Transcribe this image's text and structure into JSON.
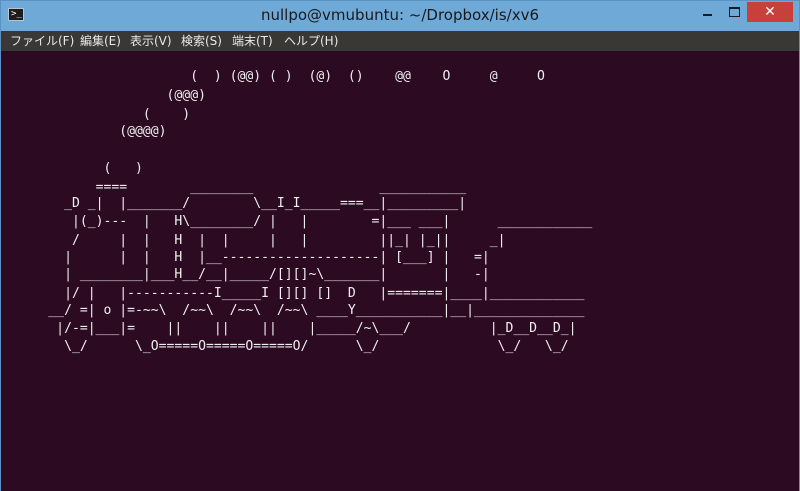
{
  "window": {
    "title": "nullpo@vmubuntu: ~/Dropbox/is/xv6",
    "app_icon_glyph": ">_",
    "close_glyph": "✕"
  },
  "menu": [
    {
      "label": "ファイル(F)"
    },
    {
      "label": "編集(E)"
    },
    {
      "label": "表示(V)"
    },
    {
      "label": "検索(S)"
    },
    {
      "label": "端末(T)"
    },
    {
      "label": "ヘルプ(H)"
    }
  ],
  "terminal": {
    "background": "#2c0a22",
    "foreground": "#f0f0f0",
    "lines": [
      "                        (  ) (@@) ( )  (@)  ()    @@    O     @     O",
      "                     (@@@)",
      "                  (    )",
      "               (@@@@)",
      "",
      "             (   )",
      "            ====        ________                ___________",
      "        _D _|  |_______/        \\__I_I_____===__|_________|",
      "         |(_)---  |   H\\________/ |   |        =|___ ___|      ____________",
      "         /     |  |   H  |  |     |   |         ||_| |_||     _|",
      "        |      |  |   H  |__--------------------| [___] |   =|",
      "        | ________|___H__/__|_____/[][]~\\_______|       |   -|",
      "        |/ |   |-----------I_____I [][] []  D   |=======|____|____________",
      "      __/ =| o |=-~~\\  /~~\\  /~~\\  /~~\\ ____Y___________|__|______________",
      "       |/-=|___|=    ||    ||    ||    |_____/~\\___/          |_D__D__D_|",
      "        \\_/      \\_O=====O=====O=====O/      \\_/               \\_/   \\_/"
    ]
  }
}
